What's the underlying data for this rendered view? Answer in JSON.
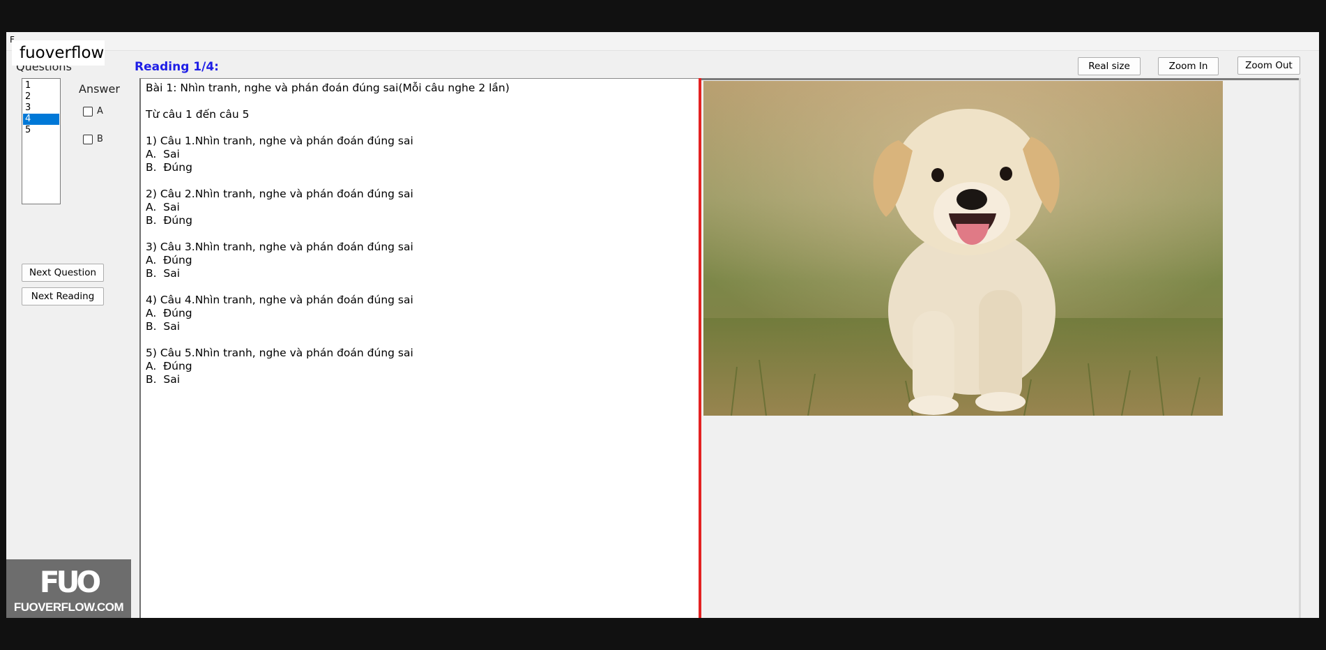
{
  "window": {
    "title_fragment": "F",
    "watermark": "fuoverflow"
  },
  "questions": {
    "label": "Questions",
    "items": [
      "1",
      "2",
      "3",
      "4",
      "5"
    ],
    "selected": "4"
  },
  "answer": {
    "label": "Answer",
    "options": [
      "A",
      "B"
    ]
  },
  "buttons": {
    "next_question": "Next Question",
    "next_reading": "Next Reading",
    "real_size": "Real size",
    "zoom_in": "Zoom In",
    "zoom_out": "Zoom Out"
  },
  "reading": {
    "title": "Reading 1/4:",
    "lines": [
      "Bài 1: Nhìn tranh, nghe và phán đoán đúng sai(Mỗi câu nghe 2 lần)",
      "",
      "Từ câu 1 đến câu 5",
      "",
      "1) Câu 1.Nhìn tranh, nghe và phán đoán đúng sai",
      "A.  Sai",
      "B.  Đúng",
      "",
      "2) Câu 2.Nhìn tranh, nghe và phán đoán đúng sai",
      "A.  Sai",
      "B.  Đúng",
      "",
      "3) Câu 3.Nhìn tranh, nghe và phán đoán đúng sai",
      "A.  Đúng",
      "B.  Sai",
      "",
      "4) Câu 4.Nhìn tranh, nghe và phán đoán đúng sai",
      "A.  Đúng",
      "B.  Sai",
      "",
      "5) Câu 5.Nhìn tranh, nghe và phán đoán đúng sai",
      "A.  Đúng",
      "B.  Sai"
    ]
  },
  "logo": {
    "mark": "FUO",
    "site": "FUOVERFLOW.COM"
  },
  "colors": {
    "reading_title": "#1e1ee6",
    "selection": "#0078d7",
    "splitter": "#e32222",
    "logo_bg": "#6d6d6d"
  }
}
